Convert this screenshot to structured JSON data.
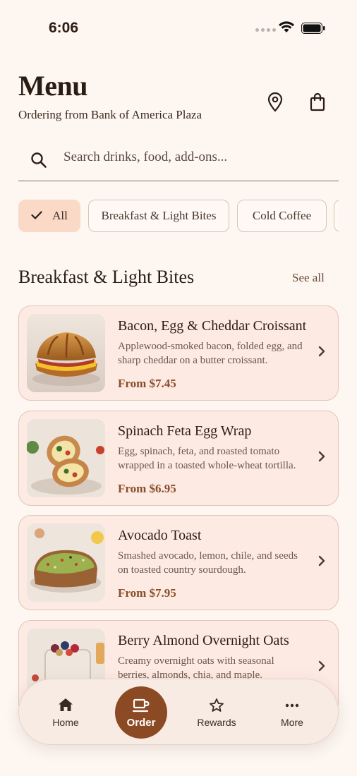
{
  "status_bar": {
    "time": "6:06"
  },
  "header": {
    "title": "Menu",
    "subtitle": "Ordering from Bank of America Plaza",
    "location_icon": "map-pin-icon",
    "bag_icon": "shopping-bag-icon"
  },
  "search": {
    "placeholder": "Search drinks, food, add-ons..."
  },
  "chips": [
    {
      "label": "All",
      "selected": true
    },
    {
      "label": "Breakfast & Light Bites",
      "selected": false
    },
    {
      "label": "Cold Coffee",
      "selected": false
    }
  ],
  "section": {
    "title": "Breakfast & Light Bites",
    "see_all": "See all"
  },
  "items": [
    {
      "name": "Bacon, Egg & Cheddar Croissant",
      "description": "Applewood-smoked bacon, folded egg, and sharp cheddar on a butter croissant.",
      "price": "From $7.45"
    },
    {
      "name": "Spinach Feta Egg Wrap",
      "description": "Egg, spinach, feta, and roasted tomato wrapped in a toasted whole-wheat tortilla.",
      "price": "From $6.95"
    },
    {
      "name": "Avocado Toast",
      "description": "Smashed avocado, lemon, chile, and seeds on toasted country sourdough.",
      "price": "From $7.95"
    },
    {
      "name": "Berry Almond Overnight Oats",
      "description": "Creamy overnight oats with seasonal berries, almonds, chia, and maple.",
      "price": ""
    }
  ],
  "tabbar": {
    "home": "Home",
    "order": "Order",
    "rewards": "Rewards",
    "more": "More"
  },
  "colors": {
    "background": "#fdf6f1",
    "accent": "#8b4a23",
    "card": "#fdeae3",
    "chip_active": "#fbd9c7",
    "price": "#8a4e2a"
  }
}
